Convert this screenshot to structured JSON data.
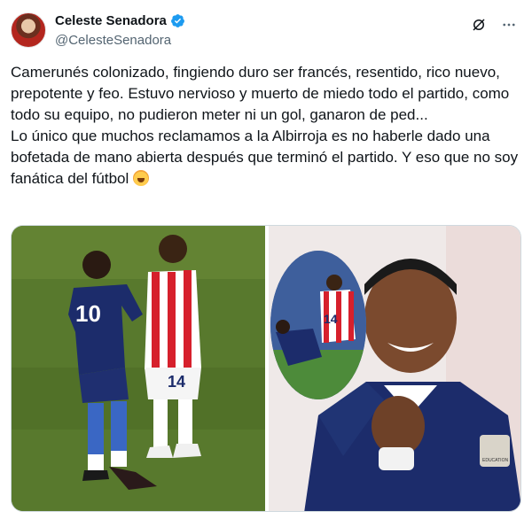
{
  "author": {
    "display_name": "Celeste Senadora",
    "handle": "@CelesteSenadora",
    "verified": true,
    "avatar_icon": "avatar-photo"
  },
  "actions": {
    "grok_icon": "grok-icon",
    "more_icon": "more-options-icon"
  },
  "tweet": {
    "paragraph_1": "Camerunés colonizado, fingiendo duro ser francés, resentido, rico nuevo, prepotente y feo. Estuvo nervioso y muerto de miedo todo el partido, como todo su equipo, no pudieron meter ni un gol, ganaron de ped...",
    "paragraph_2": "Lo único que muchos reclamamos a la Albirroja es no haberle dado una bofetada de mano abierta después que terminó el partido. Y eso que no soy fanática del fútbol",
    "emoji": "flushed-face-emoji"
  },
  "media": {
    "left_photo_numbers": {
      "blue_player": "10",
      "red_player": "14"
    },
    "right_photo_numbers": {
      "inset_player": "14"
    },
    "badge_text": "EDUCATION"
  },
  "colors": {
    "verified_blue": "#1d9bf0",
    "text": "#0f1419",
    "secondary": "#536471",
    "france_blue": "#1c2c6b",
    "paraguay_red": "#d6202c"
  }
}
